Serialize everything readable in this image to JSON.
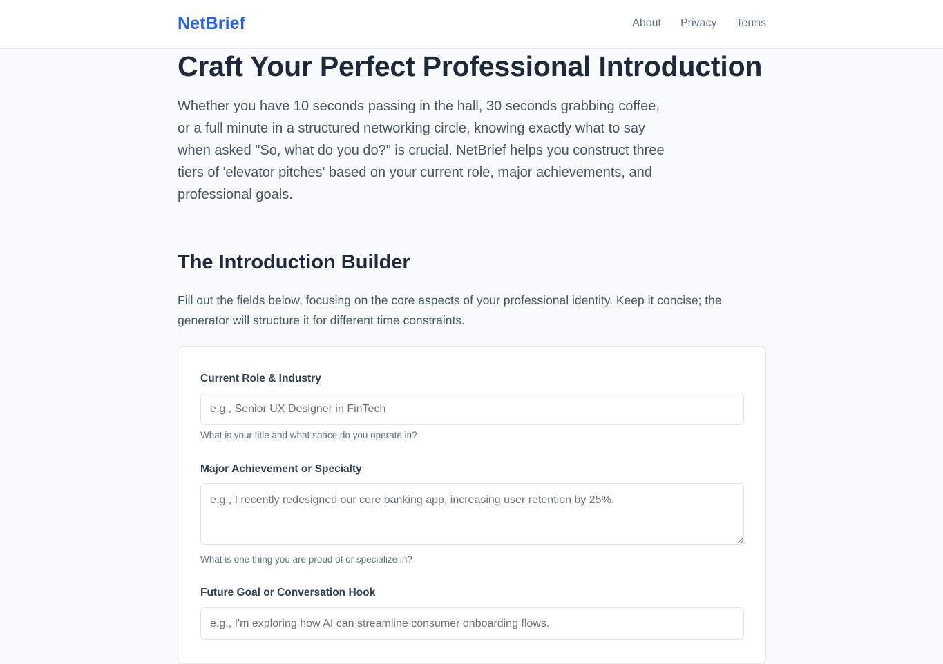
{
  "header": {
    "brand": "NetBrief",
    "nav": [
      "About",
      "Privacy",
      "Terms"
    ]
  },
  "hero": {
    "title": "Craft Your Perfect Professional Introduction",
    "text": "Whether you have 10 seconds passing in the hall, 30 seconds grabbing coffee, or a full minute in a structured networking circle, knowing exactly what to say when asked \"So, what do you do?\" is crucial. NetBrief helps you construct three tiers of 'elevator pitches' based on your current role, major achievements, and professional goals."
  },
  "builder": {
    "title": "The Introduction Builder",
    "text": "Fill out the fields below, focusing on the core aspects of your professional identity. Keep it concise; the generator will structure it for different time constraints.",
    "fields": [
      {
        "label": "Current Role & Industry",
        "placeholder": "e.g., Senior UX Designer in FinTech",
        "hint": "What is your title and what space do you operate in?"
      },
      {
        "label": "Major Achievement or Specialty",
        "placeholder": "e.g., I recently redesigned our core banking app, increasing user retention by 25%.",
        "hint": "What is one thing you are proud of or specialize in?"
      },
      {
        "label": "Future Goal or Conversation Hook",
        "placeholder": "e.g., I'm exploring how AI can streamline consumer onboarding flows."
      }
    ]
  },
  "colors": {
    "brand": "#2563eb",
    "background": "#f8fafc",
    "text": "#1e293b"
  }
}
